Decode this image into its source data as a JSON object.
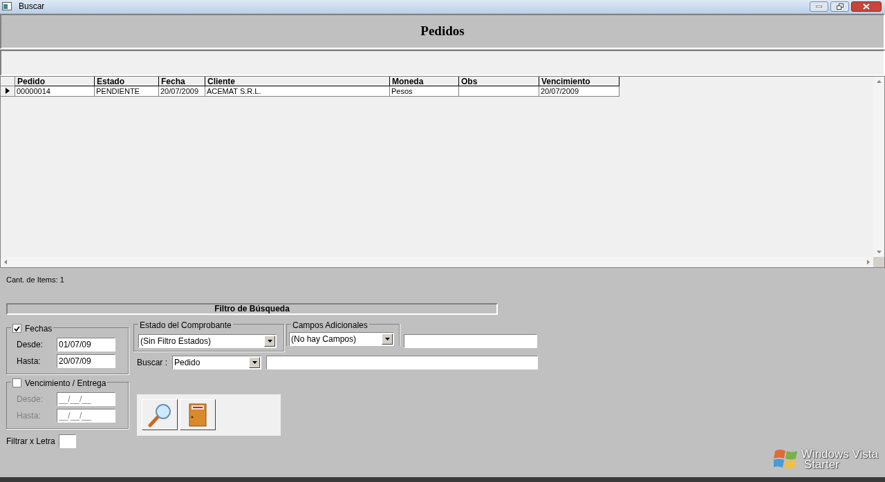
{
  "window": {
    "title": "Buscar"
  },
  "header": {
    "title": "Pedidos"
  },
  "table": {
    "columns": [
      "Pedido",
      "Estado",
      "Fecha",
      "Cliente",
      "Moneda",
      "Obs",
      "Vencimiento"
    ],
    "rows": [
      {
        "selected": true,
        "cells": [
          "00000014",
          "PENDIENTE",
          "20/07/2009",
          "ACEMAT S.R.L.",
          "Pesos",
          "",
          "20/07/2009"
        ]
      }
    ]
  },
  "item_count": "Cant. de Items: 1",
  "filter": {
    "title": "Filtro de Búsqueda",
    "fechas": {
      "label": "Fechas",
      "checked": true,
      "desde_label": "Desde:",
      "desde": "01/07/09",
      "hasta_label": "Hasta:",
      "hasta": "20/07/09"
    },
    "vencimiento": {
      "label": "Vencimiento / Entrega",
      "checked": false,
      "desde_label": "Desde:",
      "desde": "__/__/__",
      "hasta_label": "Hasta:",
      "hasta": "__/__/__"
    },
    "estado": {
      "label": "Estado del Comprobante",
      "value": "(Sin Filtro Estados)"
    },
    "campos": {
      "label": "Campos Adicionales",
      "value": "(No hay Campos)"
    },
    "buscar": {
      "label": "Buscar :",
      "value": "Pedido"
    },
    "letter_label": "Filtrar x Letra"
  },
  "watermark": [
    "Windows Vista",
    "Starter"
  ]
}
